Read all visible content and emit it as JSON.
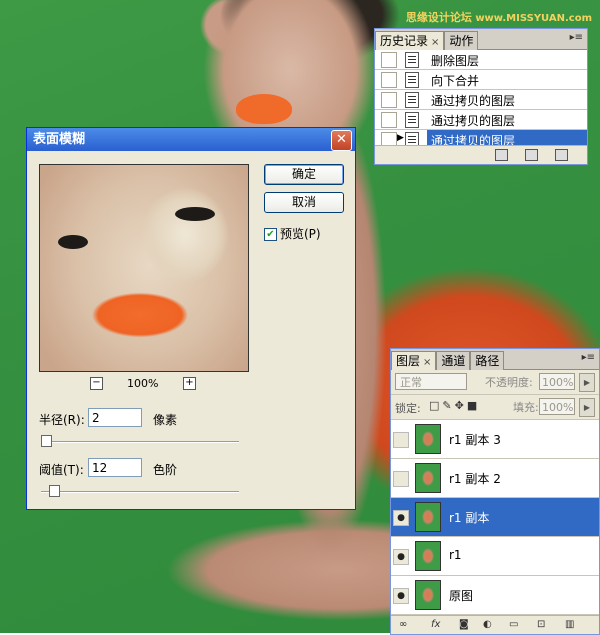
{
  "watermark": {
    "cn": "思缘设计论坛",
    "url": "www.MISSYUAN.com"
  },
  "history": {
    "tabs": [
      {
        "label": "历史记录",
        "active": true
      },
      {
        "label": "动作",
        "active": false
      }
    ],
    "close_glyph": "×",
    "items": [
      {
        "label": "删除图层",
        "selected": false
      },
      {
        "label": "向下合并",
        "selected": false
      },
      {
        "label": "通过拷贝的图层",
        "selected": false
      },
      {
        "label": "通过拷贝的图层",
        "selected": false
      },
      {
        "label": "通过拷贝的图层",
        "selected": true
      }
    ]
  },
  "dialog": {
    "title": "表面模糊",
    "close_glyph": "✕",
    "ok_label": "确定",
    "cancel_label": "取消",
    "preview_label": "预览(P)",
    "preview_checked": true,
    "zoom_minus": "−",
    "zoom_plus": "+",
    "zoom_value": "100%",
    "radius_label": "半径(R):",
    "radius_value": "2",
    "radius_unit": "像素",
    "threshold_label": "阈值(T):",
    "threshold_value": "12",
    "threshold_unit": "色阶"
  },
  "layers": {
    "tabs": [
      {
        "label": "图层",
        "active": true
      },
      {
        "label": "通道",
        "active": false
      },
      {
        "label": "路径",
        "active": false
      }
    ],
    "blend_mode": "正常",
    "opacity_label": "不透明度:",
    "opacity_value": "100%",
    "lock_label": "锁定:",
    "fill_label": "填充:",
    "fill_value": "100%",
    "items": [
      {
        "name": "r1 副本 3",
        "visible": false,
        "selected": false
      },
      {
        "name": "r1 副本 2",
        "visible": false,
        "selected": false
      },
      {
        "name": "r1 副本",
        "visible": true,
        "selected": true
      },
      {
        "name": "r1",
        "visible": true,
        "selected": false
      },
      {
        "name": "原图",
        "visible": true,
        "selected": false
      }
    ]
  },
  "colors": {
    "canvas_bg": "#3a9642",
    "selection": "#316ac5",
    "lips": "#f06a2a"
  }
}
